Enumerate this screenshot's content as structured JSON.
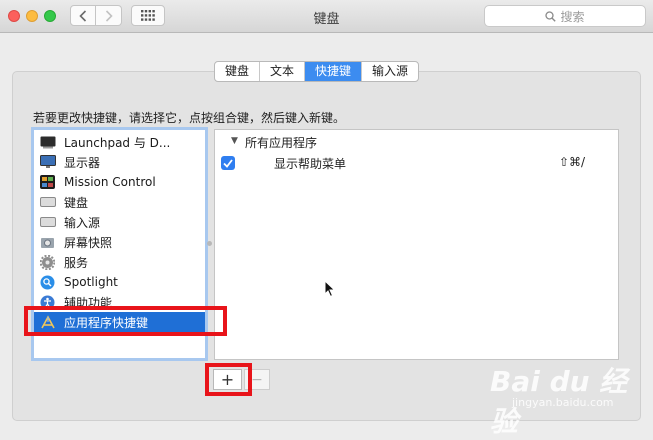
{
  "window": {
    "title": "键盘",
    "search_placeholder": "搜索"
  },
  "tabs": [
    {
      "label": "键盘",
      "active": false
    },
    {
      "label": "文本",
      "active": false
    },
    {
      "label": "快捷键",
      "active": true
    },
    {
      "label": "输入源",
      "active": false
    }
  ],
  "instruction": "若要更改快捷键，请选择它，点按组合键，然后键入新键。",
  "categories": [
    {
      "label": "Launchpad 与 D...",
      "icon": "launchpad-icon"
    },
    {
      "label": "显示器",
      "icon": "display-icon"
    },
    {
      "label": "Mission Control",
      "icon": "mission-control-icon"
    },
    {
      "label": "键盘",
      "icon": "keyboard-icon"
    },
    {
      "label": "输入源",
      "icon": "input-source-icon"
    },
    {
      "label": "屏幕快照",
      "icon": "screenshot-icon"
    },
    {
      "label": "服务",
      "icon": "gear-icon"
    },
    {
      "label": "Spotlight",
      "icon": "spotlight-icon"
    },
    {
      "label": "辅助功能",
      "icon": "accessibility-icon"
    },
    {
      "label": "应用程序快捷键",
      "icon": "app-store-icon",
      "selected": true
    }
  ],
  "shortcuts": {
    "group_label": "所有应用程序",
    "items": [
      {
        "label": "显示帮助菜单",
        "keys": "⇧⌘/",
        "checked": true
      }
    ]
  },
  "buttons": {
    "add": "+",
    "remove": "−"
  },
  "watermark": {
    "brand": "Bai du 经验",
    "site": "jingyan.baidu.com"
  },
  "colors": {
    "accent": "#3c8cf0",
    "selection": "#1f6fd6",
    "highlight": "#e8141a"
  }
}
